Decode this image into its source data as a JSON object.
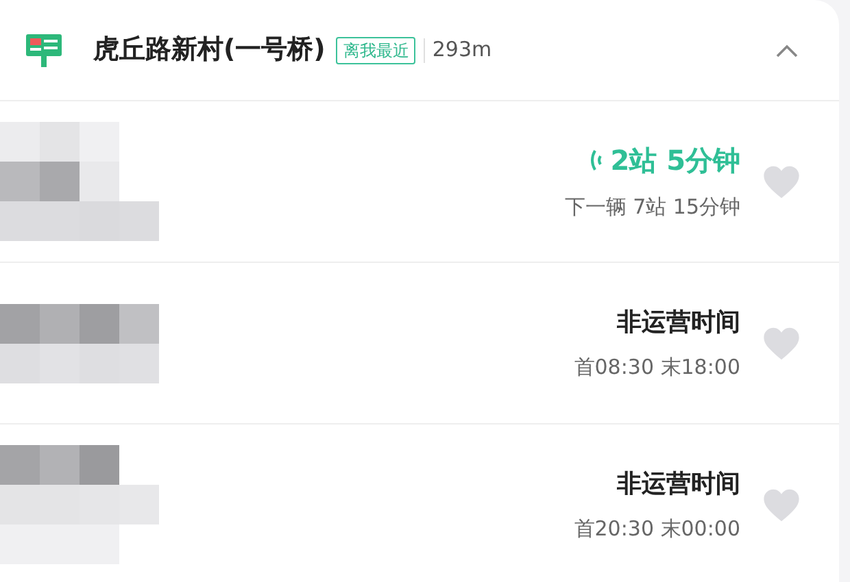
{
  "stop": {
    "name": "虎丘路新村(一号桥)",
    "badge": "离我最近",
    "distance": "293m",
    "expanded": true
  },
  "routes": [
    {
      "kind": "live",
      "primary": "2站 5分钟",
      "secondary": "下一辆 7站 15分钟",
      "favorite": false
    },
    {
      "kind": "closed",
      "primary": "非运营时间",
      "secondary": "首08:30 末18:00",
      "favorite": false
    },
    {
      "kind": "closed",
      "primary": "非运营时间",
      "secondary": "首20:30 末00:00",
      "favorite": false
    }
  ]
}
